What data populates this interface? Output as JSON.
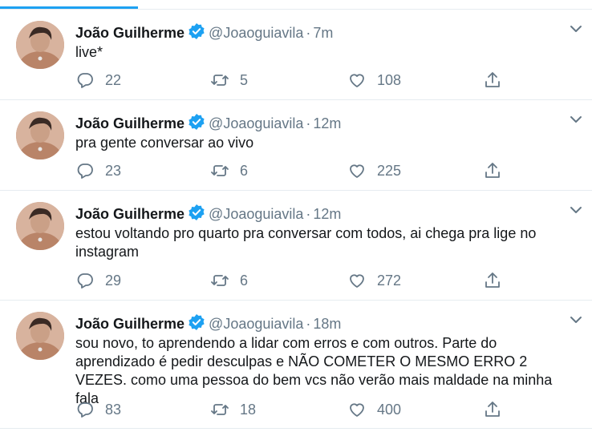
{
  "colors": {
    "accent": "#1da1f2",
    "secondary_text": "#657786",
    "divider": "#e6ecf0"
  },
  "tweets": [
    {
      "name": "João Guilherme",
      "handle": "@Joaoguiavila",
      "separator": "·",
      "time": "7m",
      "text": "live*",
      "replies": "22",
      "retweets": "5",
      "likes": "108"
    },
    {
      "name": "João Guilherme",
      "handle": "@Joaoguiavila",
      "separator": "·",
      "time": "12m",
      "text": "pra gente conversar ao vivo",
      "replies": "23",
      "retweets": "6",
      "likes": "225"
    },
    {
      "name": "João Guilherme",
      "handle": "@Joaoguiavila",
      "separator": "·",
      "time": "12m",
      "text": "estou voltando pro quarto pra conversar com todos, ai chega pra lige no instagram",
      "replies": "29",
      "retweets": "6",
      "likes": "272"
    },
    {
      "name": "João Guilherme",
      "handle": "@Joaoguiavila",
      "separator": "·",
      "time": "18m",
      "text": "sou novo, to aprendendo a lidar com erros e com outros. Parte do aprendizado é pedir desculpas e NÃO COMETER O MESMO ERRO 2 VEZES. como uma pessoa do bem vcs não verão mais maldade na minha fala",
      "replies": "83",
      "retweets": "18",
      "likes": "400"
    }
  ],
  "icons": {
    "verified": "verified-badge-icon",
    "caret": "chevron-down-icon",
    "reply": "reply-icon",
    "retweet": "retweet-icon",
    "like": "heart-icon",
    "share": "share-icon"
  }
}
